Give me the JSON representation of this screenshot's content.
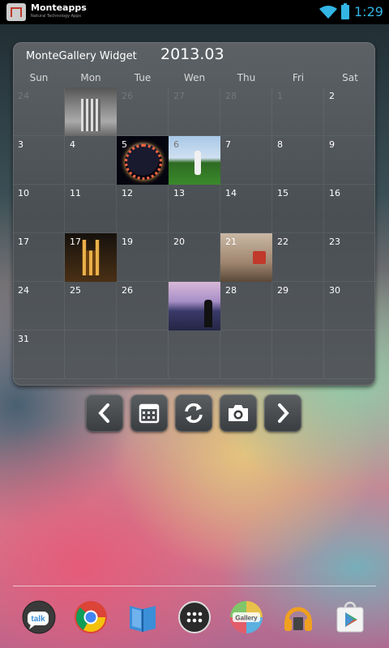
{
  "status_bar": {
    "brand": "Monteapps",
    "tagline": "Natural Technology Apps",
    "time": "1:29"
  },
  "widget": {
    "title": "MonteGallery Widget",
    "month": "2013.03",
    "weekdays": [
      "Sun",
      "Mon",
      "Tue",
      "Wen",
      "Thu",
      "Fri",
      "Sat"
    ],
    "weeks": [
      [
        {
          "d": "24",
          "dim": true
        },
        {
          "d": "",
          "photo": 0
        },
        {
          "d": "26",
          "dim": true
        },
        {
          "d": "27",
          "dim": true
        },
        {
          "d": "28",
          "dim": true
        },
        {
          "d": "1",
          "dim": true
        },
        {
          "d": "2"
        }
      ],
      [
        {
          "d": "3"
        },
        {
          "d": "4"
        },
        {
          "d": "5",
          "photo": 1
        },
        {
          "d": "6",
          "dim": true,
          "photo": 2
        },
        {
          "d": "7"
        },
        {
          "d": "8"
        },
        {
          "d": "9"
        }
      ],
      [
        {
          "d": "10"
        },
        {
          "d": "11"
        },
        {
          "d": "12"
        },
        {
          "d": "13"
        },
        {
          "d": "14"
        },
        {
          "d": "15"
        },
        {
          "d": "16"
        }
      ],
      [
        {
          "d": "17"
        },
        {
          "d": "17",
          "photo": 3
        },
        {
          "d": "19"
        },
        {
          "d": "20"
        },
        {
          "d": "21",
          "photo": 4
        },
        {
          "d": "22"
        },
        {
          "d": "23"
        }
      ],
      [
        {
          "d": "24"
        },
        {
          "d": "25"
        },
        {
          "d": "26"
        },
        {
          "d": "",
          "photo": 5
        },
        {
          "d": "28"
        },
        {
          "d": "29"
        },
        {
          "d": "30"
        }
      ],
      [
        {
          "d": "31"
        },
        {
          "d": ""
        },
        {
          "d": ""
        },
        {
          "d": ""
        },
        {
          "d": ""
        },
        {
          "d": ""
        },
        {
          "d": ""
        }
      ]
    ]
  },
  "controls": {
    "buttons": [
      "prev-month",
      "calendar",
      "refresh",
      "camera",
      "next-month"
    ]
  },
  "dock": {
    "apps": [
      "talk",
      "chrome",
      "books",
      "app-drawer",
      "gallery",
      "music",
      "play-store"
    ],
    "talk_label": "talk",
    "gallery_label": "Gallery"
  },
  "colors": {
    "accent": "#33b5e5",
    "widget_bg": "#4e5256"
  }
}
